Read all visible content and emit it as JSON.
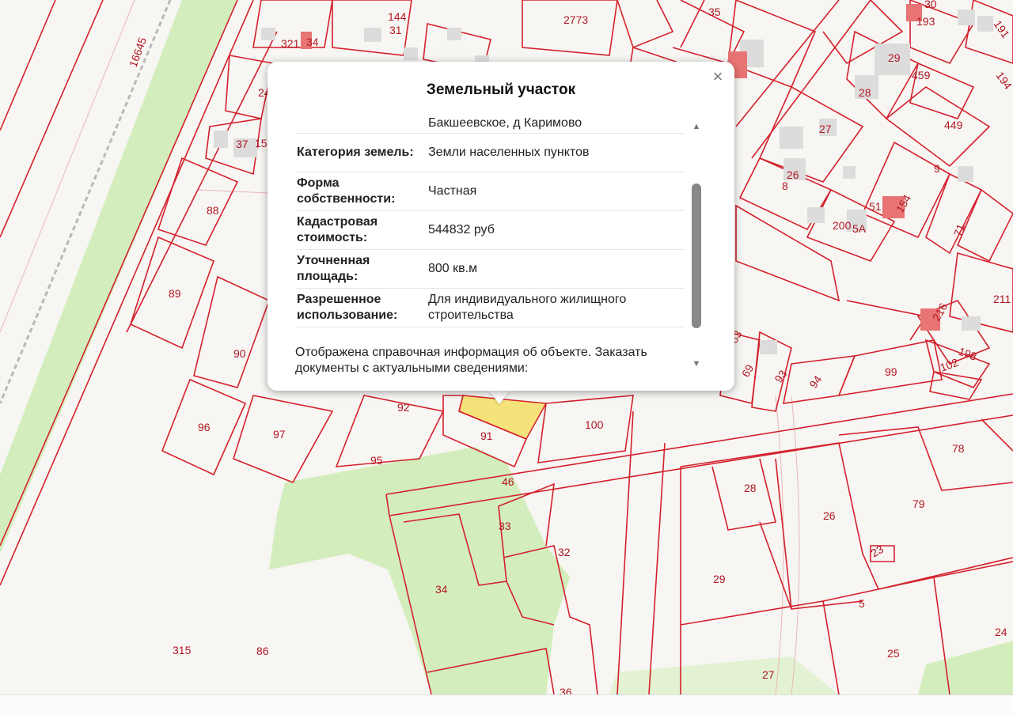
{
  "popup": {
    "title": "Земельный участок",
    "close_label": "×",
    "partial_address": "Бакшеевское, д Каримово",
    "rows": [
      {
        "key": "Категория земель:",
        "value": "Земли населенных пунктов"
      },
      {
        "key": "Форма собственности:",
        "value": "Частная"
      },
      {
        "key": "Кадастровая стоимость:",
        "value": "544832 руб"
      },
      {
        "key": "Уточненная площадь:",
        "value": "800 кв.м"
      },
      {
        "key": "Разрешенное использование:",
        "value": "Для индивидуального жилищного строительства"
      }
    ],
    "note": "Отображена справочная информация об объекте. Заказать документы с актуальными сведениями:"
  },
  "map": {
    "plot_labels": [
      "16645",
      "321",
      "34",
      "144",
      "31",
      "2773",
      "35",
      "193",
      "30",
      "191",
      "29",
      "459",
      "194",
      "28",
      "449",
      "27",
      "26",
      "8",
      "9",
      "51",
      "154",
      "200",
      "5А",
      "71",
      "211",
      "216",
      "198",
      "102",
      "99",
      "94",
      "93",
      "69",
      "83",
      "88",
      "89",
      "90",
      "96",
      "97",
      "92",
      "91",
      "95",
      "100",
      "46",
      "33",
      "32",
      "34",
      "28",
      "26",
      "79",
      "78",
      "23",
      "29",
      "5",
      "24",
      "25",
      "27",
      "36",
      "315",
      "86",
      "37",
      "15",
      "24"
    ],
    "colors": {
      "boundary": "#d4202c",
      "label": "#b01722",
      "highlight": "#f6e27a",
      "green": "#d3eebc",
      "building": "#dcdcdc",
      "building_red": "#e87474"
    }
  }
}
